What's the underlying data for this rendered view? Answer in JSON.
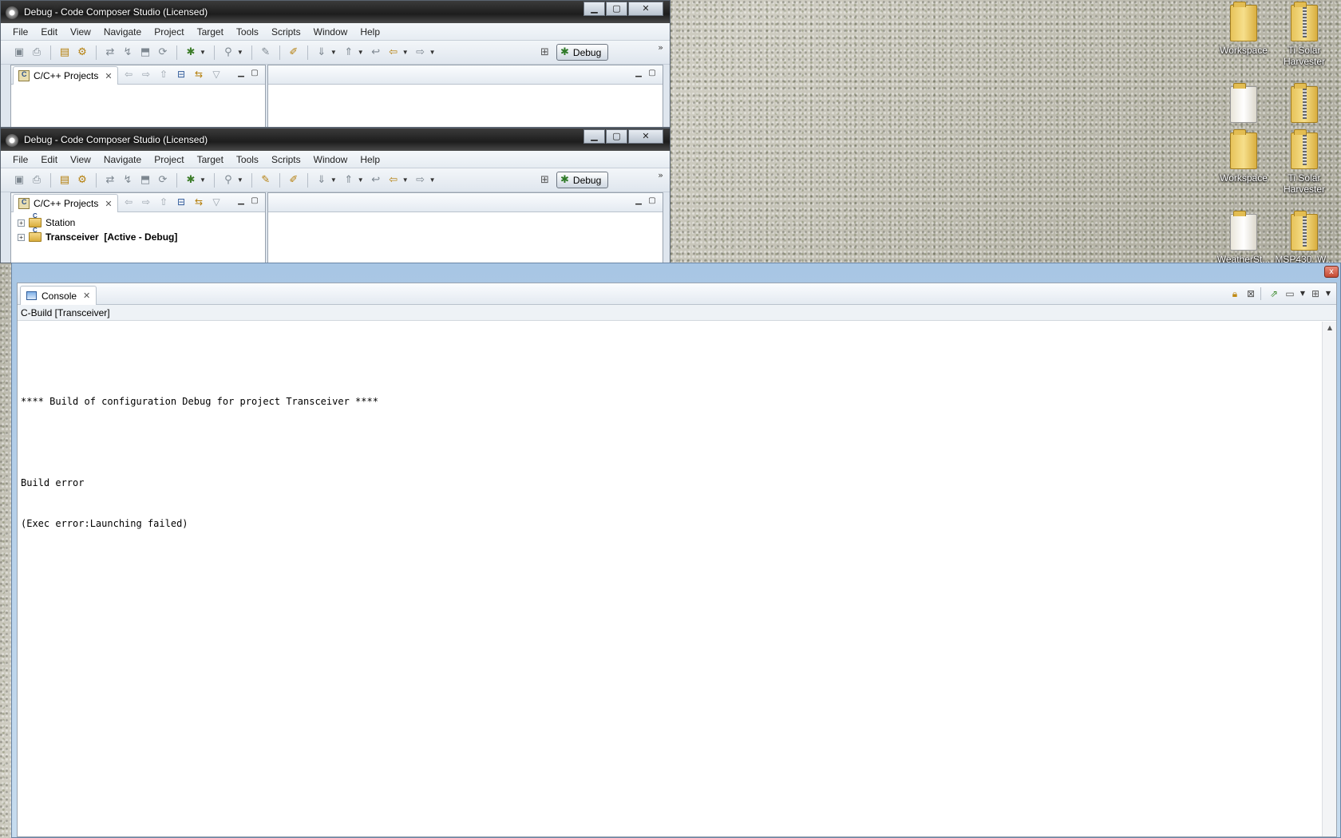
{
  "desktop": {
    "icons_top": [
      {
        "label_lines": [
          "Workspace"
        ],
        "kind": "folder"
      },
      {
        "label_lines": [
          "Ti Solar",
          "Harvester"
        ],
        "kind": "zip"
      }
    ],
    "icons_mid": [
      {
        "label_lines": [
          "Workspace"
        ],
        "kind": "folder"
      },
      {
        "label_lines": [
          "Ti Solar",
          "Harvester"
        ],
        "kind": "zip"
      }
    ],
    "icons_partial": [
      {
        "label_lines": [
          "WeatherSt..."
        ],
        "kind": "doc"
      },
      {
        "label_lines": [
          "MSP430_W..."
        ],
        "kind": "zip"
      }
    ]
  },
  "window": {
    "title": "Debug - Code Composer Studio (Licensed)",
    "controls": {
      "minimize": "▁",
      "maximize": "▢",
      "close": "✕"
    }
  },
  "menu": [
    "File",
    "Edit",
    "View",
    "Navigate",
    "Project",
    "Target",
    "Tools",
    "Scripts",
    "Window",
    "Help"
  ],
  "toolbar": {
    "perspective_label": "Debug",
    "more_glyph": "»"
  },
  "projects_view": {
    "tab_label": "C/C++ Projects",
    "close_glyph": "✕",
    "items": [
      {
        "label": "Station",
        "expander": "+",
        "bold": false
      },
      {
        "label": "Transceiver  [Active - Debug]",
        "expander": "+",
        "bold": true
      }
    ]
  },
  "console": {
    "tab_label": "Console",
    "close_glyph": "✕",
    "window_close_glyph": "x",
    "sub_label": "C-Build [Transceiver]",
    "lines": [
      "",
      "**** Build of configuration Debug for project Transceiver ****",
      "",
      "Build error",
      "(Exec error:Launching failed)"
    ]
  },
  "colors": {
    "titlebar": "#1d1d1d",
    "chrome": "#dfe6ee",
    "console_frame": "#a8c6e4"
  }
}
